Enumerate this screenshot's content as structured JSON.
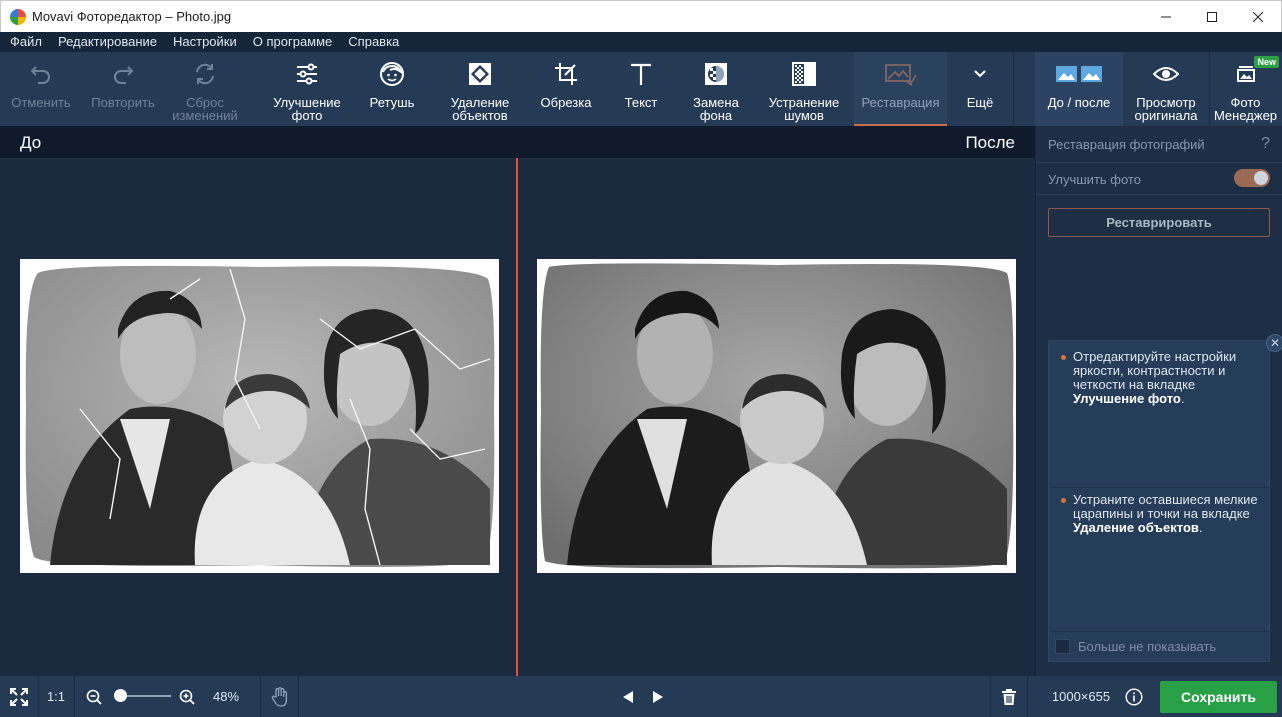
{
  "window": {
    "title": "Movavi Фоторедактор – Photo.jpg"
  },
  "menu": [
    "Файл",
    "Редактирование",
    "Настройки",
    "О программе",
    "Справка"
  ],
  "toolbar": {
    "undo": "Отменить",
    "redo": "Повторить",
    "reset": "Сброс\nизменений",
    "enhance": "Улучшение\nфото",
    "retouch": "Ретушь",
    "remove_objects": "Удаление\nобъектов",
    "crop": "Обрезка",
    "text": "Текст",
    "replace_bg": "Замена\nфона",
    "denoise": "Устранение\nшумов",
    "restore": "Реставрация",
    "more": "Ещё",
    "before_after": "До / после",
    "view_original": "Просмотр\nоригинала",
    "photo_manager": "Фото\nМенеджер",
    "new_badge": "New"
  },
  "canvas": {
    "before_label": "До",
    "after_label": "После"
  },
  "panel": {
    "title": "Реставрация фотографий",
    "help": "?",
    "enhance_label": "Улучшить фото",
    "enhance_on": true,
    "restore_button": "Реставрировать",
    "tip1_text": "Отредактируйте настройки яркости, контрастности и четкости на вкладке ",
    "tip1_bold": "Улучшение фото",
    "tip1_end": ".",
    "tip2_text": "Устраните оставшиеся мелкие царапины и точки на вкладке ",
    "tip2_bold": "Удаление объектов",
    "tip2_end": ".",
    "dont_show": "Больше не показывать"
  },
  "bottom": {
    "actual_size": "1:1",
    "zoom": "48%",
    "zoom_level": 0.1,
    "dimensions": "1000×655",
    "save": "Сохранить"
  },
  "colors": {
    "accent": "#d9563a",
    "save": "#27a046",
    "toolbar": "#253a55"
  }
}
